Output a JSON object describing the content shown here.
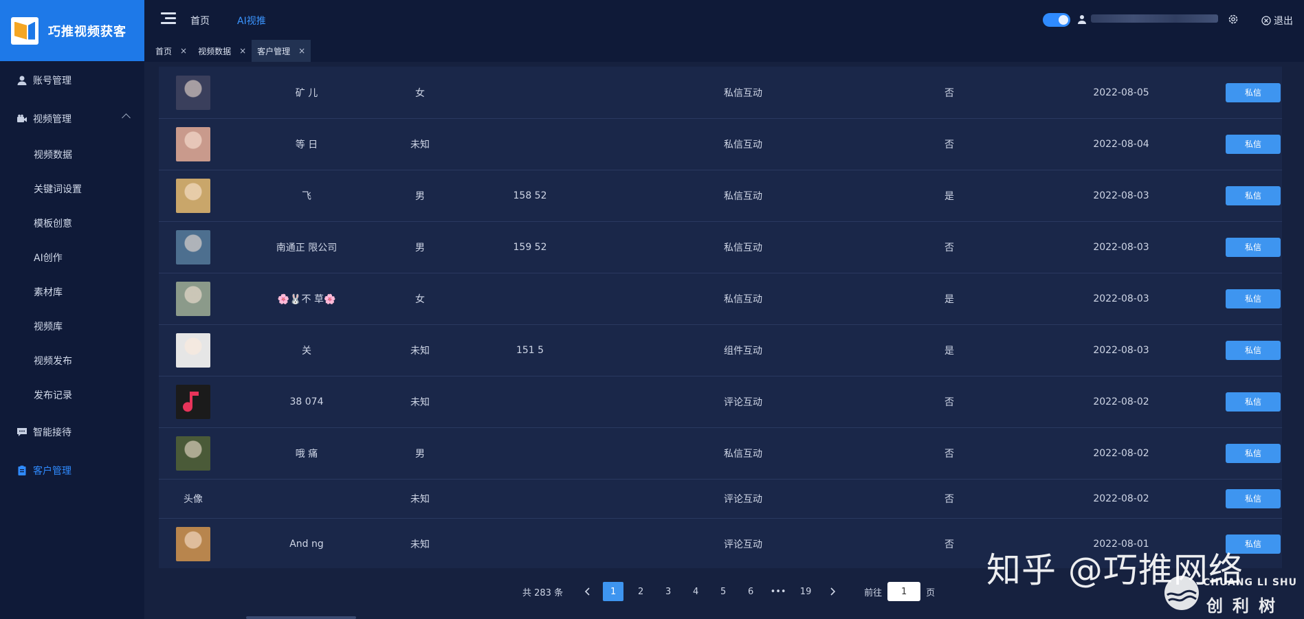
{
  "app": {
    "title": "巧推视频获客"
  },
  "topbar": {
    "nav": [
      "首页",
      "AI视推"
    ],
    "logout_label": "退出"
  },
  "tabs": [
    {
      "label": "首页",
      "close": "×"
    },
    {
      "label": "视频数据",
      "close": "×"
    },
    {
      "label": "客户管理",
      "close": "×",
      "active": true
    }
  ],
  "sidebar": {
    "items": [
      {
        "label": "账号管理",
        "icon": "user-icon"
      },
      {
        "label": "视频管理",
        "icon": "video-camera-icon",
        "expanded": true
      },
      {
        "label": "智能接待",
        "icon": "chat-icon"
      },
      {
        "label": "客户管理",
        "icon": "clipboard-icon",
        "active": true
      }
    ],
    "subitems": [
      "视频数据",
      "关键词设置",
      "模板创意",
      "AI创作",
      "素材库",
      "视频库",
      "视频发布",
      "发布记录"
    ]
  },
  "table": {
    "rows": [
      {
        "avatar": "avatar-photo",
        "name": "矿  儿",
        "gender": "女",
        "phone": "",
        "source": "私信互动",
        "flag": "否",
        "date": "2022-08-05",
        "action": "私信",
        "avatar_color": "#3a3f5c"
      },
      {
        "avatar": "avatar-photo",
        "name": "等  日",
        "gender": "未知",
        "phone": "",
        "source": "私信互动",
        "flag": "否",
        "date": "2022-08-04",
        "action": "私信",
        "avatar_color": "#c99a8c"
      },
      {
        "avatar": "avatar-photo",
        "name": "飞",
        "gender": "男",
        "phone": "158  52",
        "source": "私信互动",
        "flag": "是",
        "date": "2022-08-03",
        "action": "私信",
        "avatar_color": "#c9a66a"
      },
      {
        "avatar": "avatar-photo",
        "name": "南通正  限公司",
        "gender": "男",
        "phone": "159  52",
        "source": "私信互动",
        "flag": "否",
        "date": "2022-08-03",
        "action": "私信",
        "avatar_color": "#4d6f8f"
      },
      {
        "avatar": "avatar-photo",
        "name": "🌸🐰不  草🌸",
        "gender": "女",
        "phone": "",
        "source": "私信互动",
        "flag": "是",
        "date": "2022-08-03",
        "action": "私信",
        "avatar_color": "#8b9a8a"
      },
      {
        "avatar": "avatar-photo",
        "name": "关",
        "gender": "未知",
        "phone": "151  5",
        "source": "组件互动",
        "flag": "是",
        "date": "2022-08-03",
        "action": "私信",
        "avatar_color": "#e6e6e6"
      },
      {
        "avatar": "music-icon",
        "name": "38  074",
        "gender": "未知",
        "phone": "",
        "source": "评论互动",
        "flag": "否",
        "date": "2022-08-02",
        "action": "私信",
        "avatar_color": "#1b1b1b"
      },
      {
        "avatar": "avatar-photo",
        "name": "哦  痛",
        "gender": "男",
        "phone": "",
        "source": "私信互动",
        "flag": "否",
        "date": "2022-08-02",
        "action": "私信",
        "avatar_color": "#4a5a38"
      },
      {
        "avatar": "text",
        "avatar_text": "头像",
        "name": "",
        "gender": "未知",
        "phone": "",
        "source": "评论互动",
        "flag": "否",
        "date": "2022-08-02",
        "action": "私信"
      },
      {
        "avatar": "avatar-photo",
        "name": "And  ng",
        "gender": "未知",
        "phone": "",
        "source": "评论互动",
        "flag": "否",
        "date": "2022-08-01",
        "action": "私信",
        "avatar_color": "#b8854d"
      }
    ]
  },
  "pagination": {
    "total": "共 283 条",
    "pages": [
      "1",
      "2",
      "3",
      "4",
      "5",
      "6",
      "•••",
      "19"
    ],
    "current": "1",
    "goto_prefix": "前往",
    "goto_value": "1",
    "goto_suffix": "页"
  },
  "watermark": {
    "main": "知乎 @巧推网络",
    "brand_en": "CHUANG LI SHU",
    "brand_cn": "创利树"
  },
  "colors": {
    "accent": "#2f8bff",
    "logo_bg": "#1e79e8",
    "button": "#3e95f0",
    "sidebar_bg": "#0f1a38",
    "table_bg": "#1a2749"
  }
}
